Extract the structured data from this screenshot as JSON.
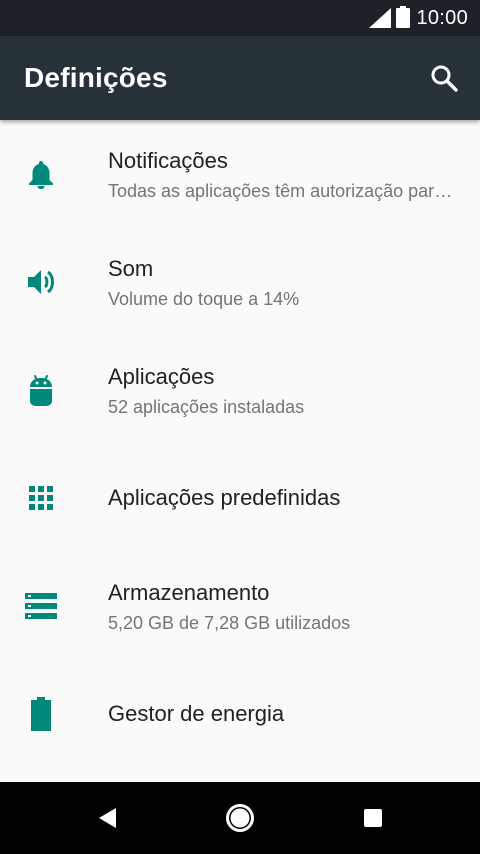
{
  "status_bar": {
    "time": "10:00"
  },
  "app_bar": {
    "title": "Definições",
    "search_icon": "search-icon"
  },
  "colors": {
    "accent": "#00897B",
    "app_bar": "#263238",
    "status_bar": "#1C2227",
    "background": "#FAFAFA"
  },
  "settings": {
    "items": [
      {
        "label": "Notificações",
        "summary": "Todas as aplicações têm autorização para enviar",
        "icon": "bell-icon"
      },
      {
        "label": "Som",
        "summary": "Volume do toque a 14%",
        "icon": "speaker-icon"
      },
      {
        "label": "Aplicações",
        "summary": "52 aplicações instaladas",
        "icon": "android-icon"
      },
      {
        "label": "Aplicações predefinidas",
        "summary": "",
        "icon": "grid-icon"
      },
      {
        "label": "Armazenamento",
        "summary": "5,20 GB de 7,28 GB utilizados",
        "icon": "storage-icon"
      },
      {
        "label": "Gestor de energia",
        "summary": "",
        "icon": "battery-icon"
      }
    ]
  },
  "nav_bar": {
    "back": "back-icon",
    "home": "home-icon",
    "recents": "recents-icon"
  }
}
